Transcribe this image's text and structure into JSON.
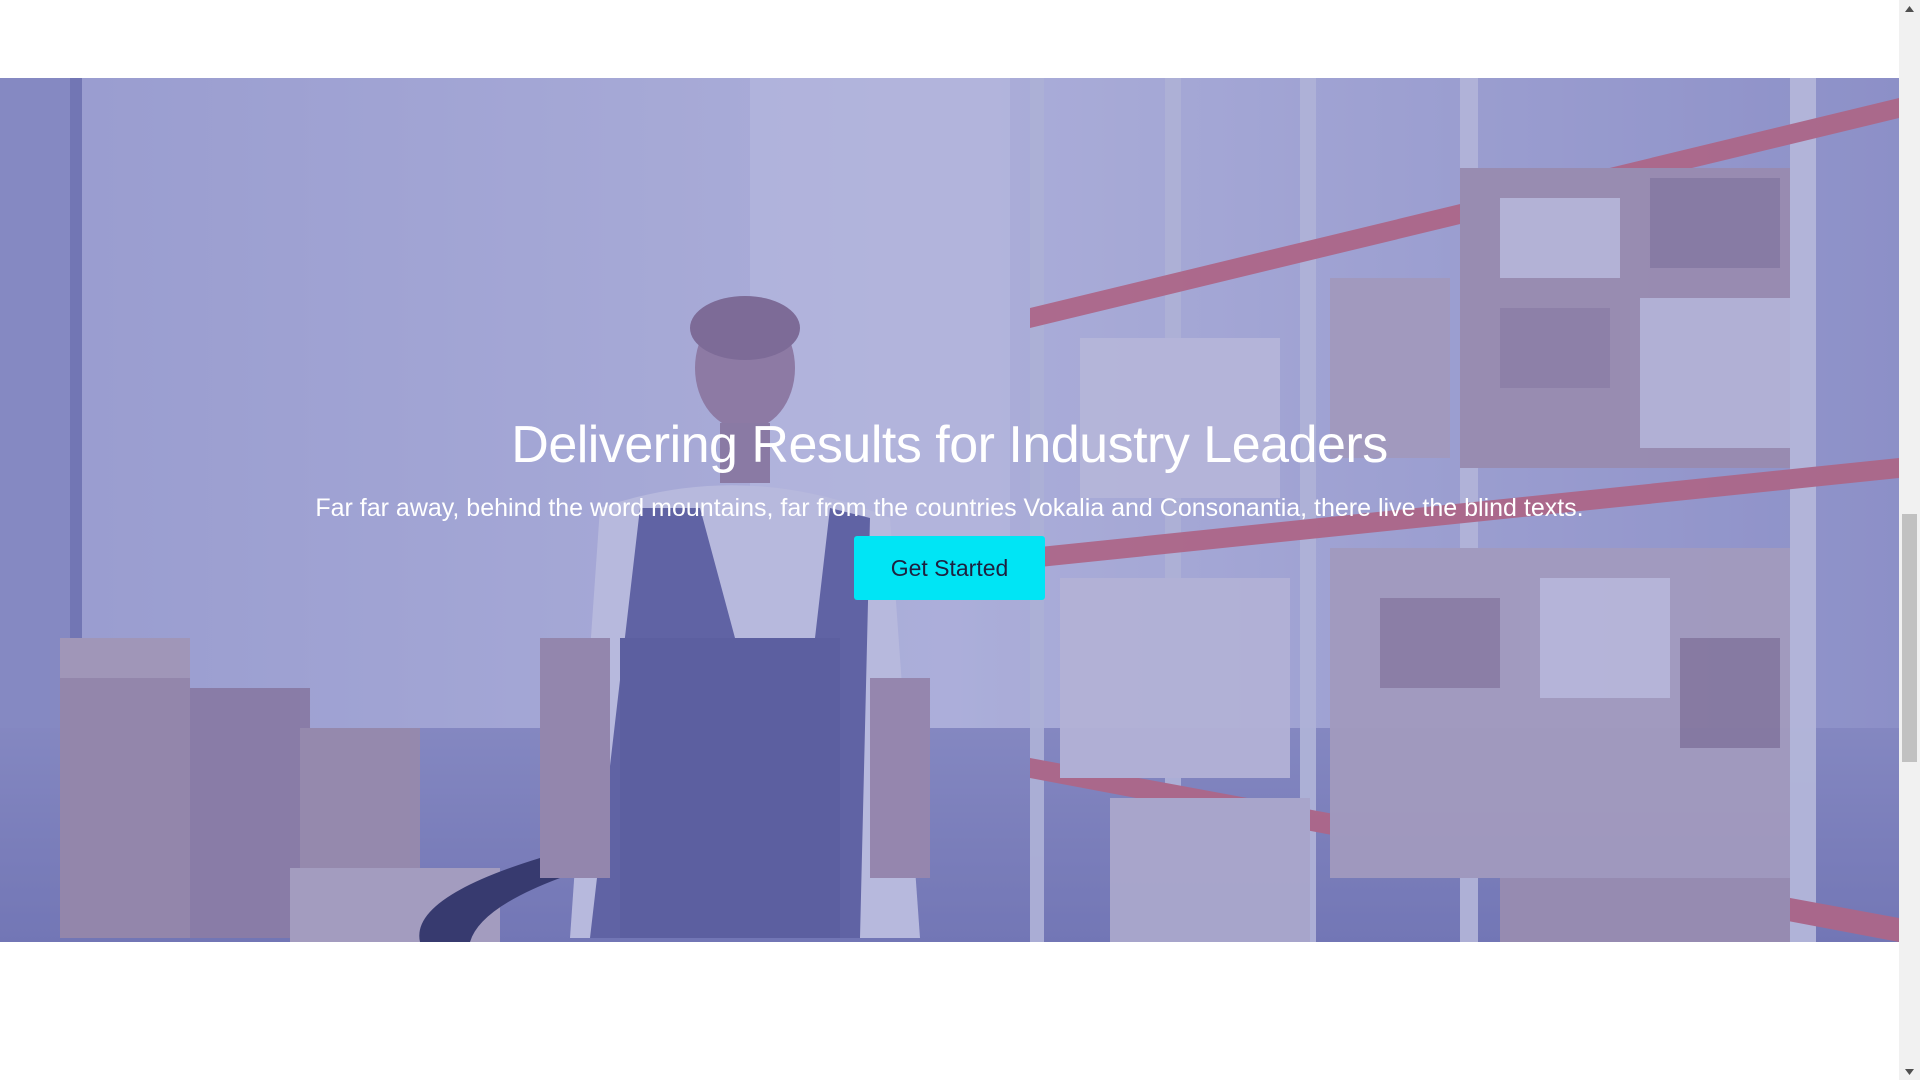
{
  "hero": {
    "title": "Delivering Results for Industry Leaders",
    "subtitle": "Far far away, behind the word mountains, far from the countries Vokalia and Consonantia, there live the blind texts.",
    "cta_label": "Get Started",
    "image": "warehouse-worker-photo",
    "overlay_color": "#5c60b4",
    "button_color": "#00e5f5"
  },
  "scrollbar": {
    "up_icon": "scroll-up-arrow-icon",
    "down_icon": "scroll-down-arrow-icon"
  }
}
